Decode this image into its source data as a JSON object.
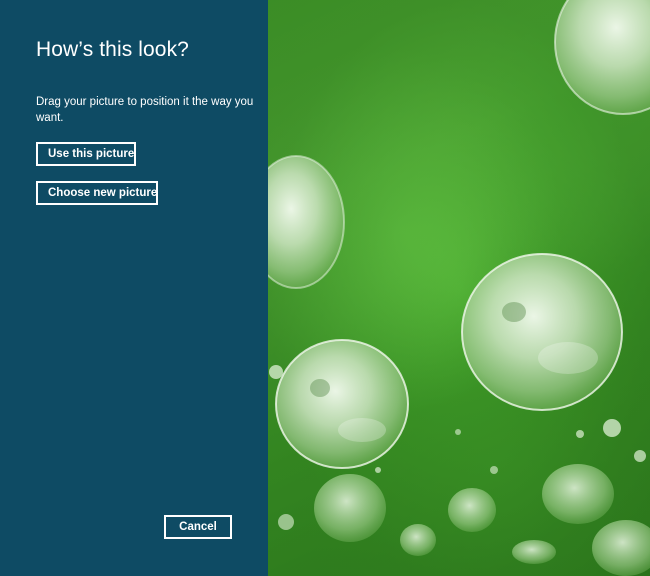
{
  "dialog": {
    "title": "How’s this look?",
    "instructions": "Drag your picture to position it the way you want.",
    "use_button_label": "Use this picture",
    "choose_button_label": "Choose new picture",
    "cancel_button_label": "Cancel"
  },
  "colors": {
    "panel_background": "#0e4b64",
    "text": "#ffffff",
    "leaf_green": "#4aa82f"
  }
}
